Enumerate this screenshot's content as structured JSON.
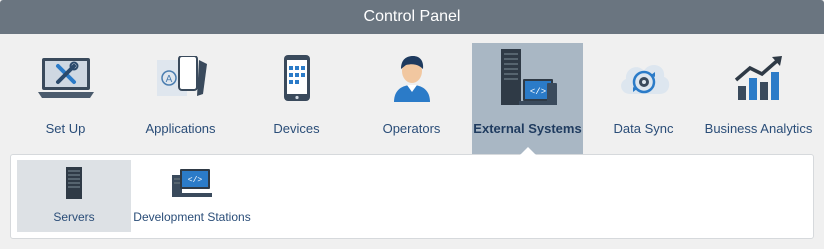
{
  "header": {
    "title": "Control Panel"
  },
  "tiles": [
    {
      "label": "Set Up",
      "icon": "laptop-tools-icon"
    },
    {
      "label": "Applications",
      "icon": "applications-icon"
    },
    {
      "label": "Devices",
      "icon": "mobile-device-icon"
    },
    {
      "label": "Operators",
      "icon": "operator-user-icon"
    },
    {
      "label": "External Systems",
      "icon": "external-systems-icon",
      "active": true
    },
    {
      "label": "Data Sync",
      "icon": "data-sync-icon"
    },
    {
      "label": "Business Analytics",
      "icon": "business-analytics-icon"
    }
  ],
  "subtiles": [
    {
      "label": "Servers",
      "icon": "server-icon",
      "active": true
    },
    {
      "label": "Development Stations",
      "icon": "development-station-icon"
    }
  ],
  "colors": {
    "titlebar": "#6a7580",
    "active_tile": "#a9b7c4",
    "label": "#2a4d78",
    "accent_blue": "#2b7bc8"
  }
}
